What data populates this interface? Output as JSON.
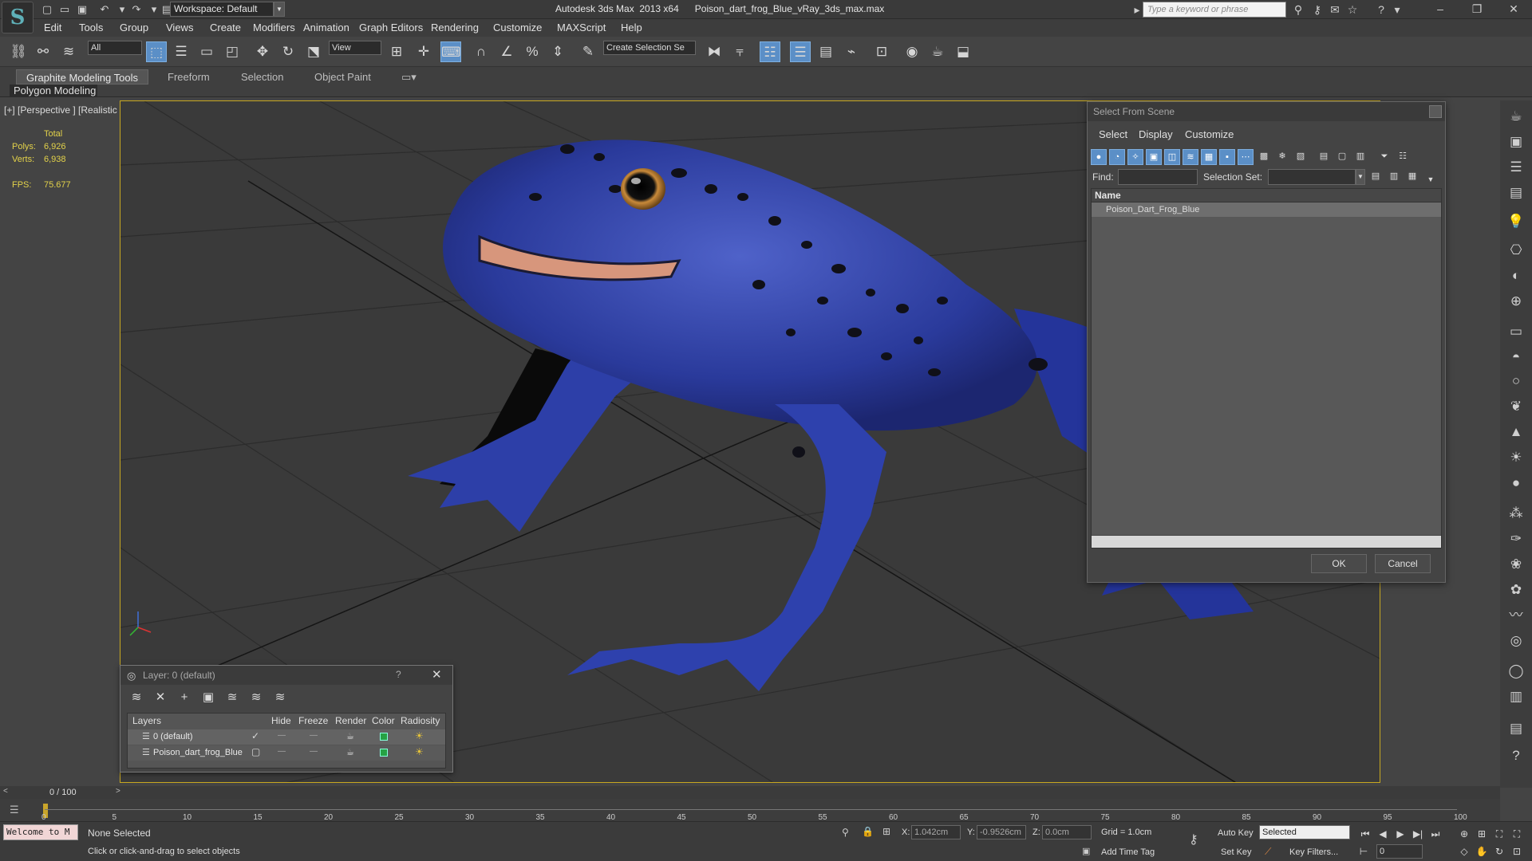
{
  "title_bar": {
    "workspace": "Workspace: Default",
    "app_title": "Autodesk 3ds Max  2013 x64",
    "file_title": "Poison_dart_frog_Blue_vRay_3ds_max.max",
    "search_placeholder": "Type a keyword or phrase"
  },
  "menu": [
    "Edit",
    "Tools",
    "Group",
    "Views",
    "Create",
    "Modifiers",
    "Animation",
    "Graph Editors",
    "Rendering",
    "Customize",
    "MAXScript",
    "Help"
  ],
  "main_toolbar": {
    "filter_value": "All",
    "coord_system": "View",
    "selection_set": "Create Selection Se"
  },
  "ribbon": {
    "tabs": [
      "Graphite Modeling Tools",
      "Freeform",
      "Selection",
      "Object Paint"
    ],
    "active_tab": "Graphite Modeling Tools",
    "sub_panel": "Polygon Modeling"
  },
  "viewport": {
    "label": "[+] [Perspective ] [Realistic ]",
    "stats": {
      "total_label": "Total",
      "polys_label": "Polys:",
      "polys_value": "6,926",
      "verts_label": "Verts:",
      "verts_value": "6,938",
      "fps_label": "FPS:",
      "fps_value": "75.677"
    }
  },
  "select_from_scene": {
    "title": "Select From Scene",
    "menu": [
      "Select",
      "Display",
      "Customize"
    ],
    "find_label": "Find:",
    "selection_set_label": "Selection Set:",
    "column_name": "Name",
    "items": [
      "Poison_Dart_Frog_Blue"
    ],
    "ok_label": "OK",
    "cancel_label": "Cancel"
  },
  "layers_dialog": {
    "title": "Layer: 0 (default)",
    "help": "?",
    "columns": [
      "Layers",
      "Hide",
      "Freeze",
      "Render",
      "Color",
      "Radiosity"
    ],
    "rows": [
      {
        "name": "0 (default)",
        "color": "#26a244"
      },
      {
        "name": "Poison_dart_frog_Blue",
        "color": "#26a244"
      }
    ]
  },
  "timeline": {
    "frame_label": "0 / 100",
    "ticks": [
      "0",
      "5",
      "10",
      "15",
      "20",
      "25",
      "30",
      "35",
      "40",
      "45",
      "50",
      "55",
      "60",
      "65",
      "70",
      "75",
      "80",
      "85",
      "90",
      "95",
      "100"
    ]
  },
  "status": {
    "maxscript": "Welcome to M",
    "selection": "None Selected",
    "prompt": "Click or click-and-drag to select objects",
    "x_label": "X:",
    "x_value": "1.042cm",
    "y_label": "Y:",
    "y_value": "-0.9526cm",
    "z_label": "Z:",
    "z_value": "0.0cm",
    "grid": "Grid = 1.0cm",
    "add_time_tag": "Add Time Tag",
    "auto_key": "Auto Key",
    "set_key": "Set Key",
    "key_mode": "Selected",
    "key_filters": "Key Filters...",
    "frame": "0"
  }
}
